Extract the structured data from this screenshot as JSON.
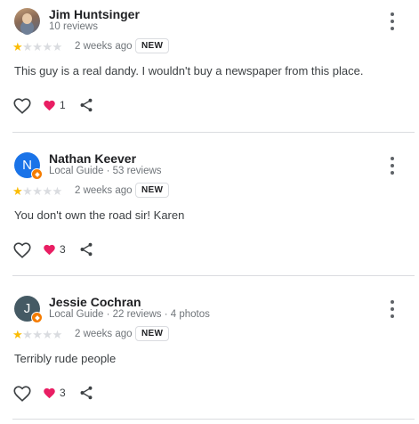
{
  "reviews": [
    {
      "name": "Jim Huntsinger",
      "meta": "10 reviews",
      "avatar_initial": "",
      "avatar_type": "photo",
      "rating": 1,
      "when": "2 weeks ago",
      "badge": "NEW",
      "text": "This guy is a real dandy. I wouldn't buy a newspaper from this place.",
      "likes": "1"
    },
    {
      "name": "Nathan Keever",
      "meta": "Local Guide · 53 reviews",
      "avatar_initial": "N",
      "avatar_color": "#1a73e8",
      "avatar_type": "letter",
      "rating": 1,
      "when": "2 weeks ago",
      "badge": "NEW",
      "text": "You don't own the road sir! Karen",
      "likes": "3"
    },
    {
      "name": "Jessie Cochran",
      "meta": "Local Guide · 22 reviews · 4 photos",
      "avatar_initial": "J",
      "avatar_color": "#455a64",
      "avatar_type": "letter",
      "rating": 1,
      "when": "2 weeks ago",
      "badge": "NEW",
      "text": "Terribly rude people",
      "likes": "3"
    }
  ],
  "icons": {
    "more": "more-vert-icon",
    "like": "heart-outline-icon",
    "reaction": "heart-filled-icon",
    "share": "share-icon"
  },
  "colors": {
    "star_on": "#fbbc04",
    "star_off": "#dadce0",
    "reaction": "#e91e63",
    "local_guide_badge": "#f57c00"
  }
}
